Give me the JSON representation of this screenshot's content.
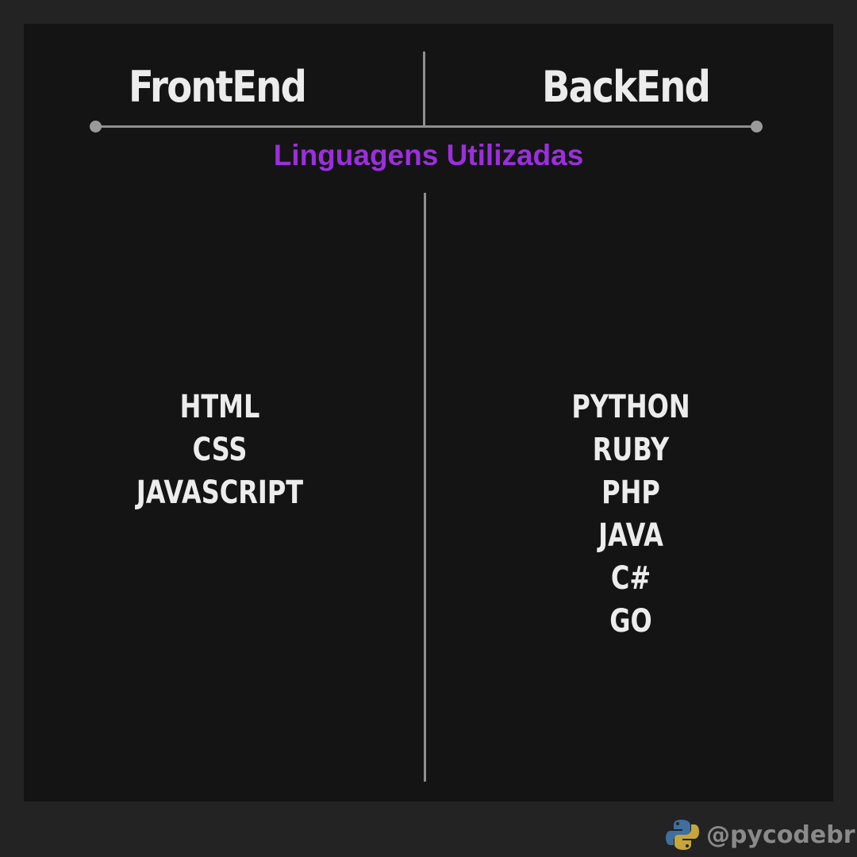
{
  "columns": {
    "left": {
      "title": "FrontEnd",
      "items": [
        "HTML",
        "CSS",
        "JAVASCRIPT"
      ]
    },
    "right": {
      "title": "BackEnd",
      "items": [
        "PYTHON",
        "RUBY",
        "PHP",
        "JAVA",
        "C#",
        "GO"
      ]
    }
  },
  "subtitle": "Linguagens Utilizadas",
  "watermark": {
    "handle": "@pycodebr",
    "icon": "python-logo-icon"
  },
  "colors": {
    "background": "#141414",
    "frame": "#232323",
    "subtitle": "#9b2fdc",
    "text": "#ececec",
    "divider": "#8f8f8f"
  }
}
